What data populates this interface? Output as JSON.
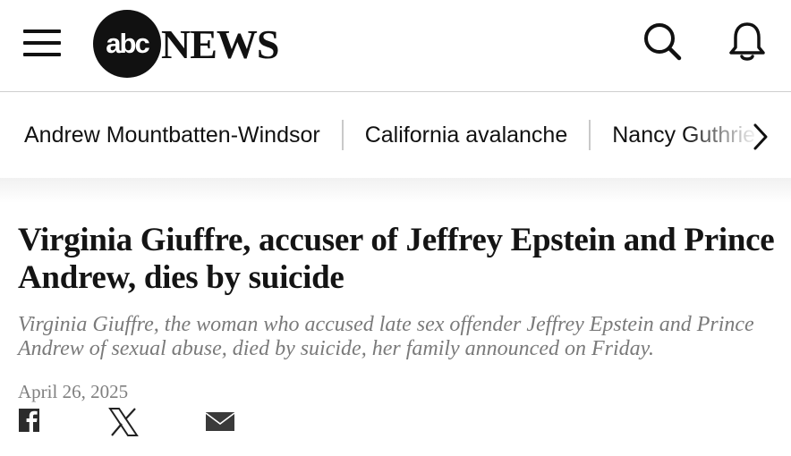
{
  "header": {
    "logo_mark": "abc",
    "logo_text": "NEWS",
    "icons": [
      "hamburger-menu-icon",
      "search-icon",
      "bell-icon"
    ]
  },
  "topics": {
    "items": [
      {
        "label": "Andrew Mountbatten-Windsor"
      },
      {
        "label": "California avalanche"
      },
      {
        "label": "Nancy Guthrie"
      }
    ],
    "next_icon": "chevron-right-icon"
  },
  "article": {
    "headline": "Virginia Giuffre, accuser of Jeffrey Epstein and Prince Andrew, dies by suicide",
    "dek": "Virginia Giuffre, the woman who accused late sex offender Jeffrey Epstein and Prince Andrew of sexual abuse, died by suicide, her family announced on Friday.",
    "date": "April 26, 2025"
  },
  "share": {
    "icons": [
      "facebook-icon",
      "x-icon",
      "email-icon"
    ]
  },
  "colors": {
    "text": "#111111",
    "dek": "#7a7a7a",
    "date": "#808080",
    "divider": "#c9c9c9"
  }
}
